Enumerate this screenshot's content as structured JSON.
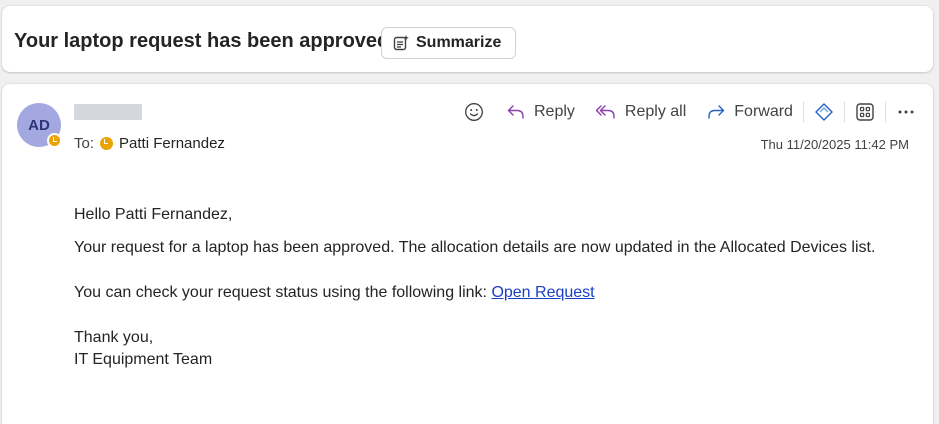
{
  "subject": {
    "title": "Your laptop request has been approved",
    "summarize_label": "Summarize"
  },
  "message": {
    "avatar_initials": "AD",
    "to_label": "To:",
    "recipient": "Patti Fernandez",
    "timestamp": "Thu 11/20/2025 11:42 PM",
    "toolbar": {
      "emoji_icon": "emoji-icon",
      "reply_label": "Reply",
      "reply_all_label": "Reply all",
      "forward_label": "Forward"
    },
    "body": {
      "greeting": "Hello Patti Fernandez,",
      "paragraph1": "Your request for a laptop has been approved. The allocation details are now updated in the Allocated Devices list.",
      "paragraph2_prefix": "You can check your request status using the following link: ",
      "link_text": "Open Request",
      "closing": "Thank you,",
      "signature": "IT Equipment Team"
    }
  },
  "colors": {
    "avatar_bg": "#a3a9e0",
    "presence_away": "#eaa300",
    "reply_all_accent": "#8a3fa8",
    "forward_accent": "#2561c8",
    "link": "#1a3fc7"
  }
}
